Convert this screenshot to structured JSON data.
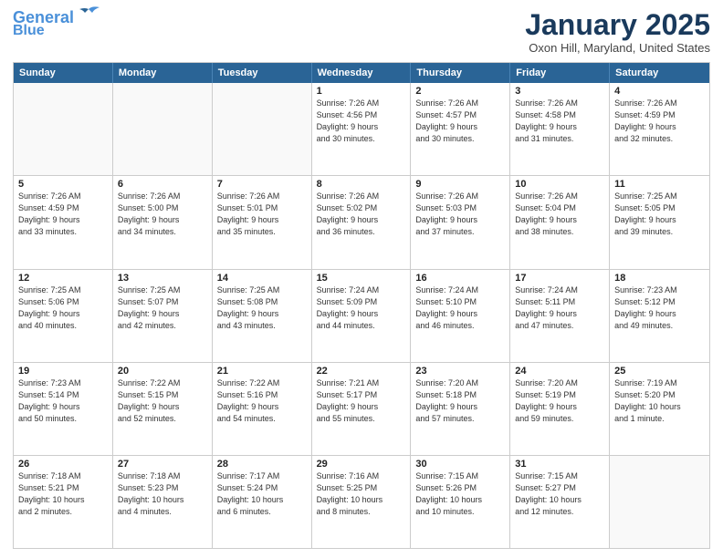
{
  "header": {
    "logo_line1": "General",
    "logo_line2": "Blue",
    "month_title": "January 2025",
    "location": "Oxon Hill, Maryland, United States"
  },
  "day_headers": [
    "Sunday",
    "Monday",
    "Tuesday",
    "Wednesday",
    "Thursday",
    "Friday",
    "Saturday"
  ],
  "weeks": [
    [
      {
        "num": "",
        "info": ""
      },
      {
        "num": "",
        "info": ""
      },
      {
        "num": "",
        "info": ""
      },
      {
        "num": "1",
        "info": "Sunrise: 7:26 AM\nSunset: 4:56 PM\nDaylight: 9 hours\nand 30 minutes."
      },
      {
        "num": "2",
        "info": "Sunrise: 7:26 AM\nSunset: 4:57 PM\nDaylight: 9 hours\nand 30 minutes."
      },
      {
        "num": "3",
        "info": "Sunrise: 7:26 AM\nSunset: 4:58 PM\nDaylight: 9 hours\nand 31 minutes."
      },
      {
        "num": "4",
        "info": "Sunrise: 7:26 AM\nSunset: 4:59 PM\nDaylight: 9 hours\nand 32 minutes."
      }
    ],
    [
      {
        "num": "5",
        "info": "Sunrise: 7:26 AM\nSunset: 4:59 PM\nDaylight: 9 hours\nand 33 minutes."
      },
      {
        "num": "6",
        "info": "Sunrise: 7:26 AM\nSunset: 5:00 PM\nDaylight: 9 hours\nand 34 minutes."
      },
      {
        "num": "7",
        "info": "Sunrise: 7:26 AM\nSunset: 5:01 PM\nDaylight: 9 hours\nand 35 minutes."
      },
      {
        "num": "8",
        "info": "Sunrise: 7:26 AM\nSunset: 5:02 PM\nDaylight: 9 hours\nand 36 minutes."
      },
      {
        "num": "9",
        "info": "Sunrise: 7:26 AM\nSunset: 5:03 PM\nDaylight: 9 hours\nand 37 minutes."
      },
      {
        "num": "10",
        "info": "Sunrise: 7:26 AM\nSunset: 5:04 PM\nDaylight: 9 hours\nand 38 minutes."
      },
      {
        "num": "11",
        "info": "Sunrise: 7:25 AM\nSunset: 5:05 PM\nDaylight: 9 hours\nand 39 minutes."
      }
    ],
    [
      {
        "num": "12",
        "info": "Sunrise: 7:25 AM\nSunset: 5:06 PM\nDaylight: 9 hours\nand 40 minutes."
      },
      {
        "num": "13",
        "info": "Sunrise: 7:25 AM\nSunset: 5:07 PM\nDaylight: 9 hours\nand 42 minutes."
      },
      {
        "num": "14",
        "info": "Sunrise: 7:25 AM\nSunset: 5:08 PM\nDaylight: 9 hours\nand 43 minutes."
      },
      {
        "num": "15",
        "info": "Sunrise: 7:24 AM\nSunset: 5:09 PM\nDaylight: 9 hours\nand 44 minutes."
      },
      {
        "num": "16",
        "info": "Sunrise: 7:24 AM\nSunset: 5:10 PM\nDaylight: 9 hours\nand 46 minutes."
      },
      {
        "num": "17",
        "info": "Sunrise: 7:24 AM\nSunset: 5:11 PM\nDaylight: 9 hours\nand 47 minutes."
      },
      {
        "num": "18",
        "info": "Sunrise: 7:23 AM\nSunset: 5:12 PM\nDaylight: 9 hours\nand 49 minutes."
      }
    ],
    [
      {
        "num": "19",
        "info": "Sunrise: 7:23 AM\nSunset: 5:14 PM\nDaylight: 9 hours\nand 50 minutes."
      },
      {
        "num": "20",
        "info": "Sunrise: 7:22 AM\nSunset: 5:15 PM\nDaylight: 9 hours\nand 52 minutes."
      },
      {
        "num": "21",
        "info": "Sunrise: 7:22 AM\nSunset: 5:16 PM\nDaylight: 9 hours\nand 54 minutes."
      },
      {
        "num": "22",
        "info": "Sunrise: 7:21 AM\nSunset: 5:17 PM\nDaylight: 9 hours\nand 55 minutes."
      },
      {
        "num": "23",
        "info": "Sunrise: 7:20 AM\nSunset: 5:18 PM\nDaylight: 9 hours\nand 57 minutes."
      },
      {
        "num": "24",
        "info": "Sunrise: 7:20 AM\nSunset: 5:19 PM\nDaylight: 9 hours\nand 59 minutes."
      },
      {
        "num": "25",
        "info": "Sunrise: 7:19 AM\nSunset: 5:20 PM\nDaylight: 10 hours\nand 1 minute."
      }
    ],
    [
      {
        "num": "26",
        "info": "Sunrise: 7:18 AM\nSunset: 5:21 PM\nDaylight: 10 hours\nand 2 minutes."
      },
      {
        "num": "27",
        "info": "Sunrise: 7:18 AM\nSunset: 5:23 PM\nDaylight: 10 hours\nand 4 minutes."
      },
      {
        "num": "28",
        "info": "Sunrise: 7:17 AM\nSunset: 5:24 PM\nDaylight: 10 hours\nand 6 minutes."
      },
      {
        "num": "29",
        "info": "Sunrise: 7:16 AM\nSunset: 5:25 PM\nDaylight: 10 hours\nand 8 minutes."
      },
      {
        "num": "30",
        "info": "Sunrise: 7:15 AM\nSunset: 5:26 PM\nDaylight: 10 hours\nand 10 minutes."
      },
      {
        "num": "31",
        "info": "Sunrise: 7:15 AM\nSunset: 5:27 PM\nDaylight: 10 hours\nand 12 minutes."
      },
      {
        "num": "",
        "info": ""
      }
    ]
  ]
}
